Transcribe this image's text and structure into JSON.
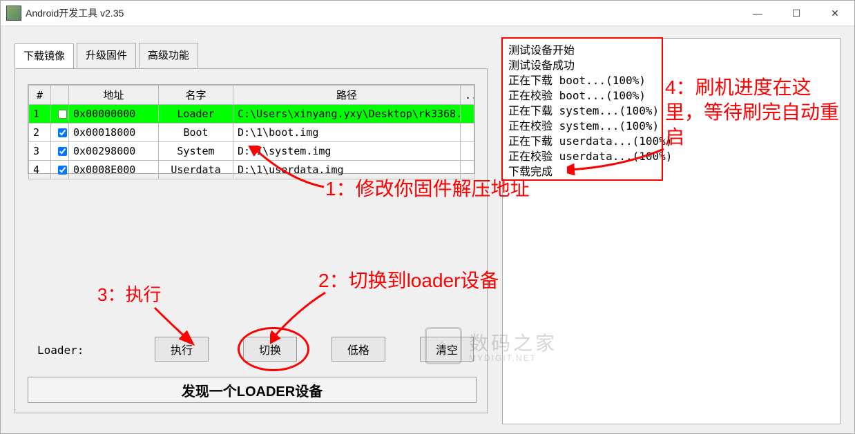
{
  "window": {
    "title": "Android开发工具 v2.35"
  },
  "tabs": [
    {
      "label": "下载镜像",
      "active": true
    },
    {
      "label": "升级固件",
      "active": false
    },
    {
      "label": "高级功能",
      "active": false
    }
  ],
  "table": {
    "headers": {
      "num": "#",
      "addr": "地址",
      "name": "名字",
      "path": "路径",
      "end": "..."
    },
    "rows": [
      {
        "num": "1",
        "checked": false,
        "addr": "0x00000000",
        "name": "Loader",
        "path": "C:\\Users\\xinyang.yxy\\Desktop\\rk3368...",
        "selected": true
      },
      {
        "num": "2",
        "checked": true,
        "addr": "0x00018000",
        "name": "Boot",
        "path": "D:\\1\\boot.img",
        "selected": false
      },
      {
        "num": "3",
        "checked": true,
        "addr": "0x00298000",
        "name": "System",
        "path": "D:\\1\\system.img",
        "selected": false
      },
      {
        "num": "4",
        "checked": true,
        "addr": "0x0008E000",
        "name": "Userdata",
        "path": "D:\\1\\userdata.img",
        "selected": false
      }
    ]
  },
  "loader_label": "Loader:",
  "buttons": {
    "exec": "执行",
    "switch": "切换",
    "lowfmt": "低格",
    "clear": "清空"
  },
  "status": "发现一个LOADER设备",
  "log": [
    "测试设备开始",
    "测试设备成功",
    "正在下载 boot...(100%)",
    "正在校验 boot...(100%)",
    "正在下载 system...(100%)",
    "正在校验 system...(100%)",
    "正在下载 userdata...(100%)",
    "正在校验 userdata...(100%)",
    "下载完成"
  ],
  "annotations": {
    "a1": "1：修改你固件解压地址",
    "a2": "2：切换到loader设备",
    "a3": "3：执行",
    "a4": "4：刷机进度在这里，等待刷完自动重启"
  },
  "watermark": {
    "main": "数码之家",
    "sub": "MYDIGIT.NET"
  }
}
